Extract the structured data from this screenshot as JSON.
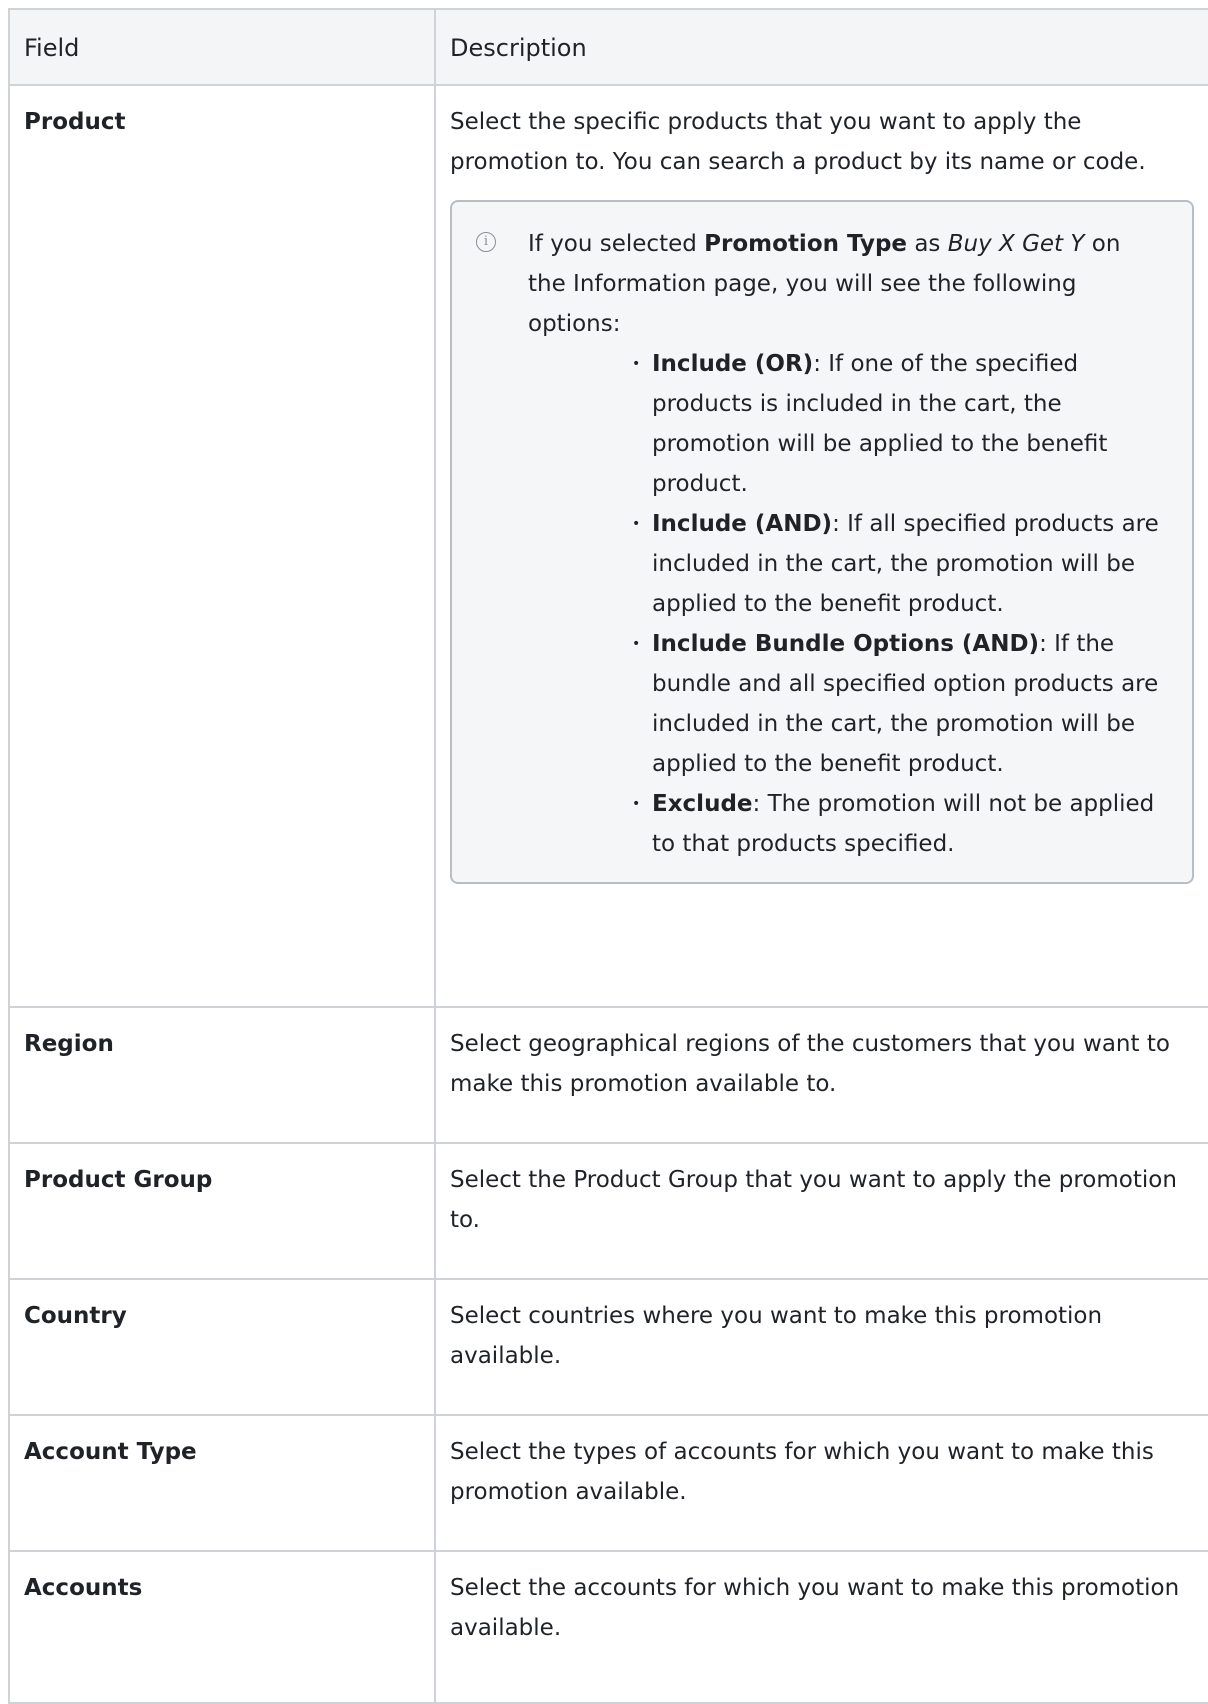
{
  "table": {
    "headers": {
      "field": "Field",
      "description": "Description"
    },
    "rows": [
      {
        "field": "Product",
        "description": "Select the specific products that you want to apply the promotion to. You can search a product by its name or code.",
        "note": {
          "prefix": "If you selected ",
          "bold": "Promotion Type",
          "mid": " as ",
          "italic": "Buy X Get Y",
          "suffix": " on the Information page, you will see the following options:",
          "items": [
            {
              "term": "Include (OR)",
              "text": ": If one of the specified products is included in the cart, the promotion will be applied to the benefit product."
            },
            {
              "term": "Include (AND)",
              "text": ": If all specified products are included in the cart, the promotion will be applied to the benefit product."
            },
            {
              "term": "Include Bundle Options (AND)",
              "text": ": If the bundle and all specified option products are included in the cart, the promotion will be applied to the benefit product."
            },
            {
              "term": "Exclude",
              "text": ": The promotion will not be applied to that products specified."
            }
          ]
        }
      },
      {
        "field": "Region",
        "description": "Select geographical regions of the customers that you want to make this promotion available to."
      },
      {
        "field": "Product Group",
        "description": "Select the Product Group that you want to apply the promotion to."
      },
      {
        "field": "Country",
        "description": "Select countries where you want to make this promotion available."
      },
      {
        "field": "Account Type",
        "description": "Select the types of accounts for which you want to make this promotion available."
      },
      {
        "field": "Accounts",
        "description": "Select the accounts for which you want to make this promotion available."
      }
    ]
  },
  "icons": {
    "note": "info-circle-icon"
  }
}
